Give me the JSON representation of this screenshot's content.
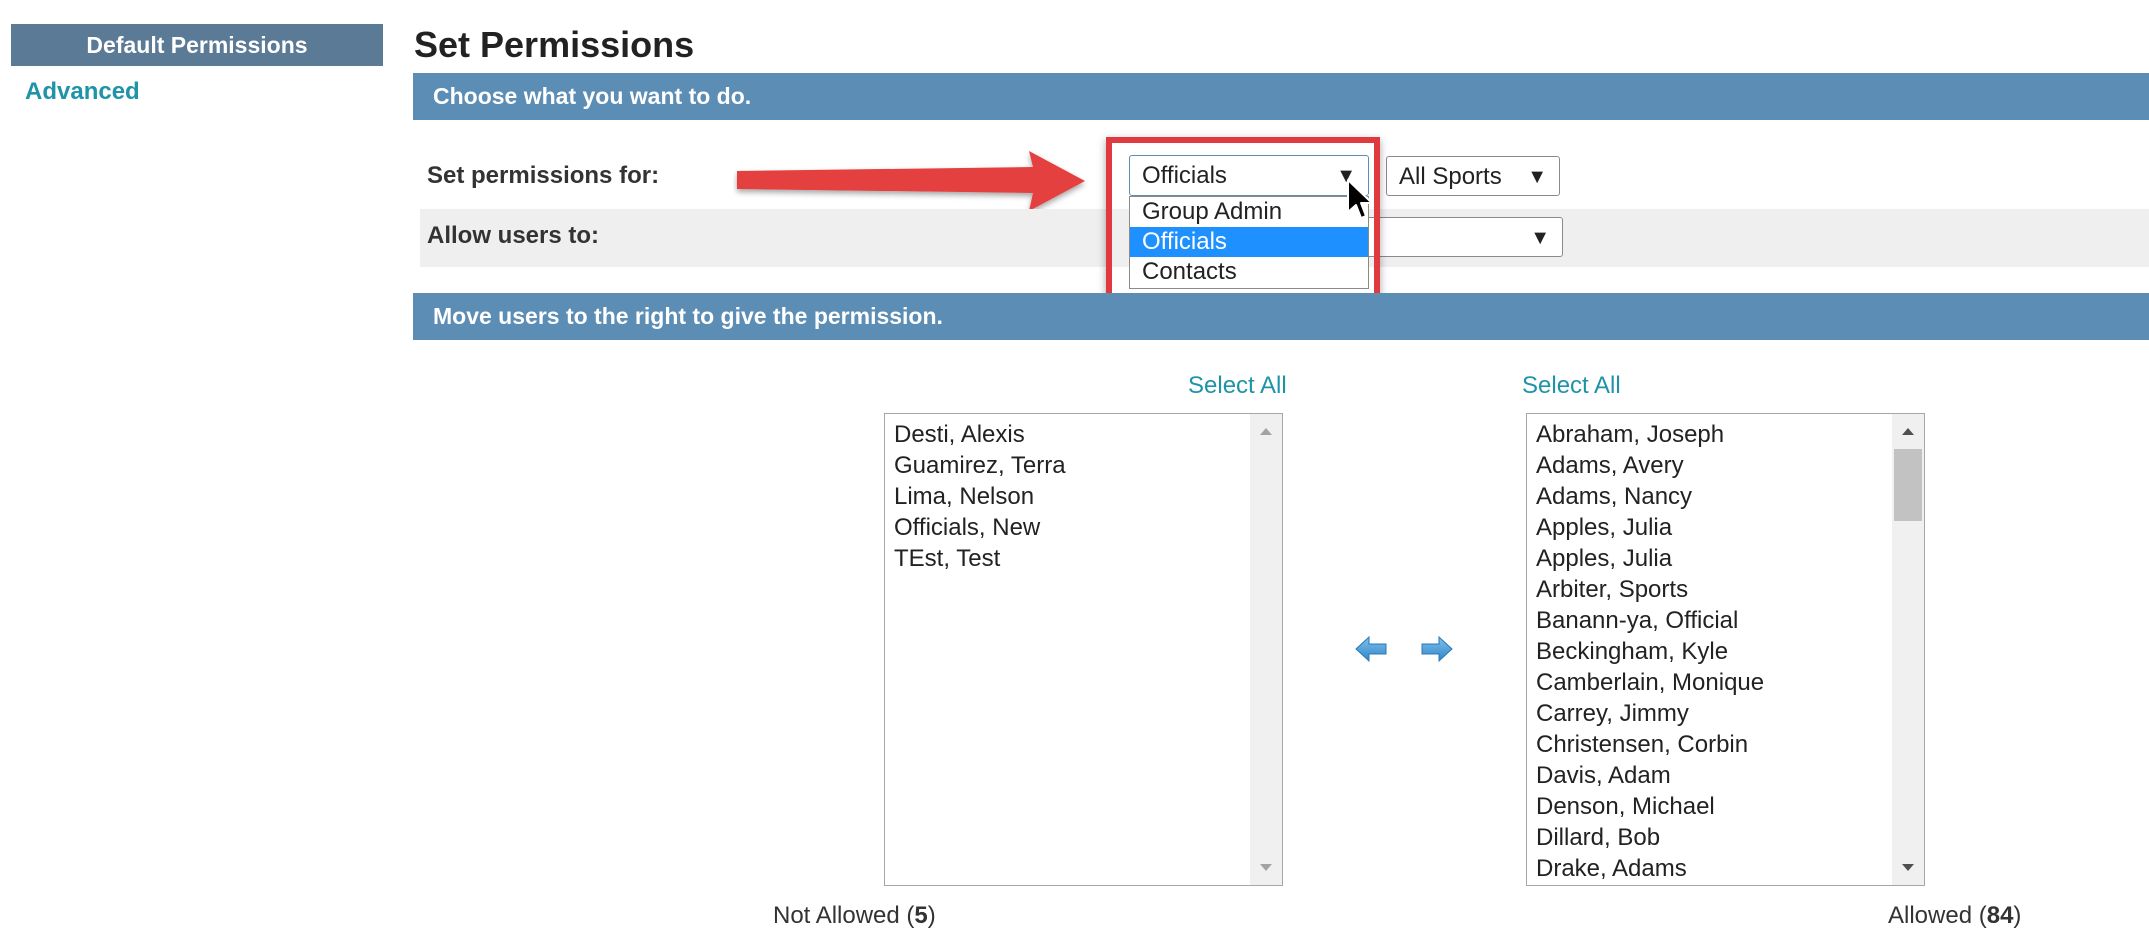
{
  "sidebar": {
    "header": "Default Permissions",
    "link": "Advanced"
  },
  "page": {
    "title": "Set Permissions",
    "section1": "Choose what you want to do.",
    "section2": "Move users to the right to give the permission."
  },
  "form": {
    "set_for_label": "Set permissions for:",
    "set_for_value": "Officials",
    "set_for_options": [
      "Group Admin",
      "Officials",
      "Contacts"
    ],
    "sport_value": "All Sports",
    "allow_label": "Allow users to:"
  },
  "lists": {
    "select_all_left": "Select All",
    "select_all_right": "Select All",
    "not_allowed": [
      "Desti, Alexis",
      "Guamirez, Terra",
      "Lima, Nelson",
      "Officials, New",
      "TEst, Test"
    ],
    "allowed": [
      "Abraham, Joseph",
      "Adams, Avery",
      "Adams, Nancy",
      "Apples, Julia",
      "Apples, Julia",
      "Arbiter, Sports",
      "Banann-ya, Official",
      "Beckingham, Kyle",
      "Camberlain, Monique",
      "Carrey, Jimmy",
      "Christensen, Corbin",
      "Davis, Adam",
      "Denson, Michael",
      "Dillard, Bob",
      "Drake, Adams"
    ],
    "not_allowed_label": "Not Allowed (",
    "not_allowed_count": "5",
    "allowed_label": "Allowed (",
    "allowed_count": "84",
    "close_paren": ")"
  },
  "icons": {
    "move_left": "arrow-left-icon",
    "move_right": "arrow-right-icon",
    "annotation": "annotation-arrow"
  },
  "colors": {
    "section_band": "#5b8db5",
    "sidebar_header": "#5a7a96",
    "link": "#1f93a8",
    "annotation_red": "#e03a3e",
    "selected_option": "#1e90ff"
  }
}
